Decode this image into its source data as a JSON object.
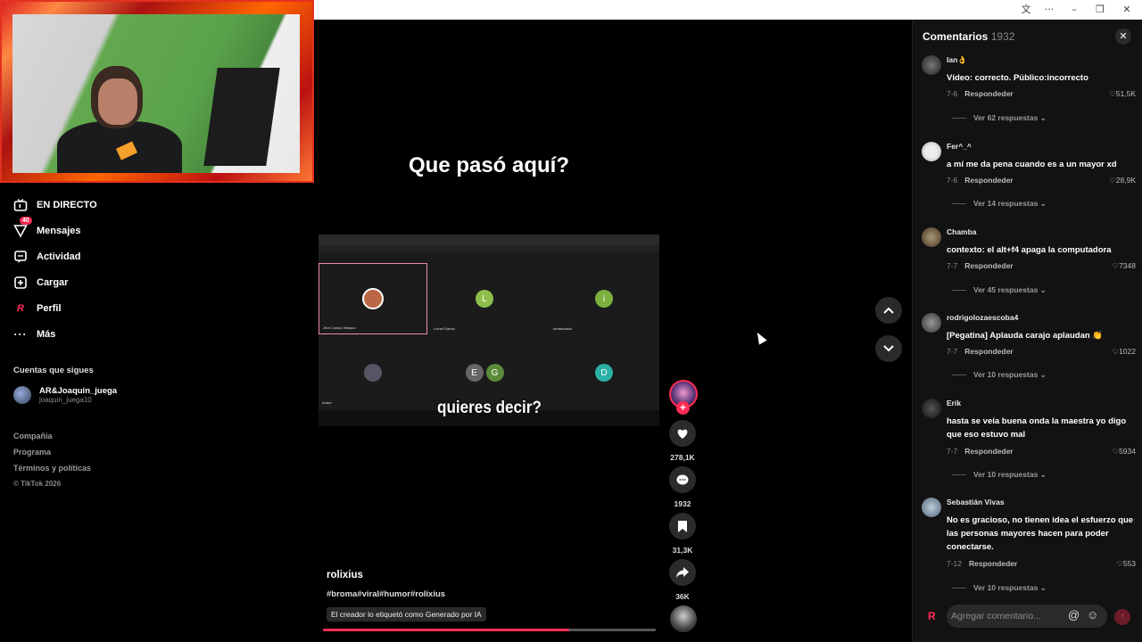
{
  "titlebar": {
    "translate_icon": "translate-icon",
    "menu_icon": "more-icon",
    "minimize": "–",
    "maximize": "❐",
    "close": "✕"
  },
  "sidebar": {
    "items": [
      {
        "label": "EN DIRECTO",
        "icon": "live-tv-icon"
      },
      {
        "label": "Mensajes",
        "icon": "send-icon",
        "badge": "40"
      },
      {
        "label": "Actividad",
        "icon": "activity-icon"
      },
      {
        "label": "Cargar",
        "icon": "upload-icon"
      },
      {
        "label": "Perfil",
        "icon": "profile-icon"
      },
      {
        "label": "Más",
        "icon": "more-icon"
      }
    ],
    "following_title": "Cuentas que sigues",
    "following": [
      {
        "name": "AR&Joaquín_juega",
        "handle": "joaquin_juega10"
      }
    ],
    "footer": [
      "Compañía",
      "Programa",
      "Términos y políticas"
    ],
    "copyright": "© TikTok 2026"
  },
  "video": {
    "title": "Que pasó aquí?",
    "caption": "quieres decir?",
    "tiles": [
      {
        "initial": "",
        "name": "Jhon Carlos Velasco",
        "color": "#7a1448"
      },
      {
        "initial": "L",
        "name": "Lionel Garcia",
        "color": "#4b7a18"
      },
      {
        "initial": "i",
        "name": "Inmaculada",
        "color": "#3d7a16"
      },
      {
        "initial": "",
        "name": "Andre",
        "color": "#143a52"
      },
      {
        "initial": "E G",
        "name": "",
        "color": "#3a3a3a"
      },
      {
        "initial": "D",
        "name": "",
        "color": "#0f7d75"
      }
    ],
    "author": "rolixius",
    "tags": "#broma#viral#humor#rolixius",
    "ai_label": "El creador lo etiquetó como Generado por IA",
    "progress": 0.74
  },
  "actions": {
    "likes": "278,1K",
    "comments": "1932",
    "saves": "31,3K",
    "shares": "36K"
  },
  "comments_panel": {
    "title": "Comentarios",
    "count": "1932",
    "reply_label": "Respondeder",
    "input_placeholder": "Agregar comentario...",
    "comments": [
      {
        "user": "Ian👌",
        "text": "Vídeo: correcto. Público:incorrecto",
        "date": "7-6",
        "likes": "51,5K",
        "more": "Ver 62 respuestas"
      },
      {
        "user": "Fer^_^",
        "text": "a mí me da pena cuando es a un mayor xd",
        "date": "7-6",
        "likes": "28,9K",
        "more": "Ver 14 respuestas"
      },
      {
        "user": "Chamba",
        "text": "contexto: el alt+f4 apaga la computadora",
        "date": "7-7",
        "likes": "7348",
        "more": "Ver 45 respuestas"
      },
      {
        "user": "rodrigolozaescoba4",
        "text": "[Pegatina] Aplauda carajo aplaudan 👏",
        "date": "7-7",
        "likes": "1022",
        "more": "Ver 10 respuestas"
      },
      {
        "user": "Erik",
        "text": "hasta se veía buena onda la maestra yo digo que eso estuvo mal",
        "date": "7-7",
        "likes": "5934",
        "more": "Ver 10 respuestas"
      },
      {
        "user": "Sebastián Vivas",
        "text": "No es gracioso, no tienen idea el esfuerzo que las personas mayores hacen para poder conectarse.",
        "date": "7-12",
        "likes": "553",
        "more": "Ver 10 respuestas"
      }
    ]
  }
}
